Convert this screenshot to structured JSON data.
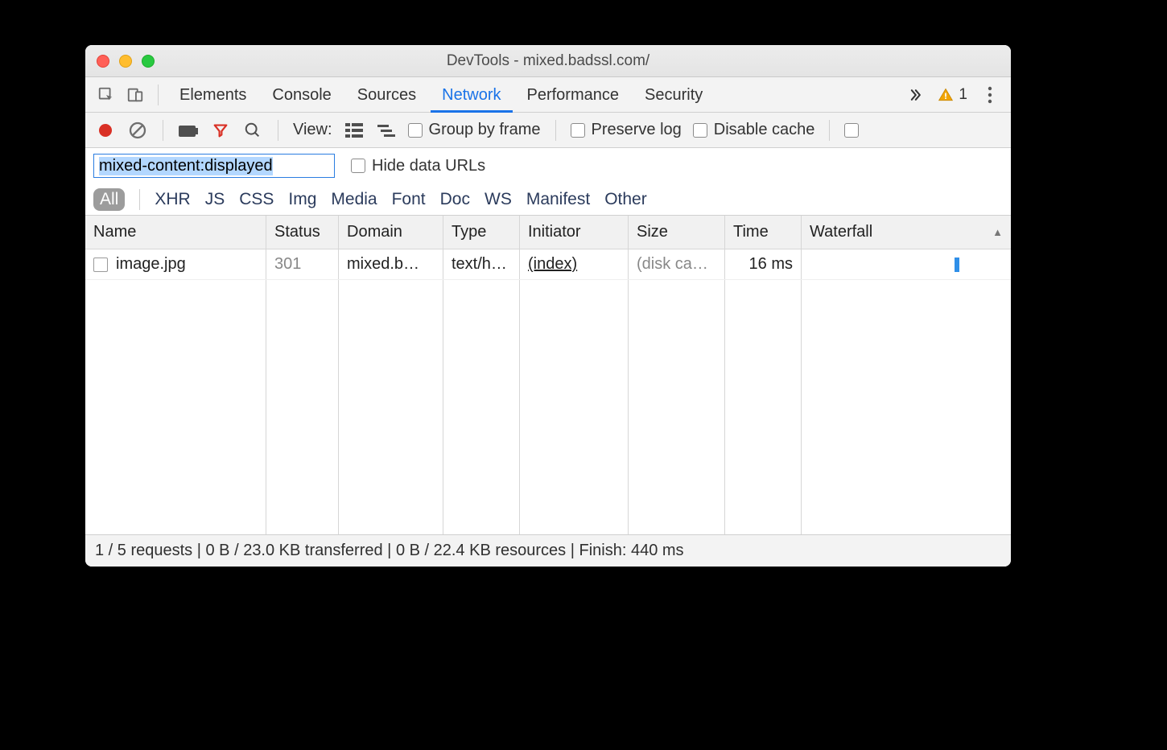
{
  "window": {
    "title": "DevTools - mixed.badssl.com/"
  },
  "tabs": {
    "items": [
      "Elements",
      "Console",
      "Sources",
      "Network",
      "Performance",
      "Security"
    ],
    "active": "Network",
    "warning_count": "1"
  },
  "toolbar": {
    "view_label": "View:",
    "group_by_frame": "Group by frame",
    "preserve_log": "Preserve log",
    "disable_cache": "Disable cache"
  },
  "filter": {
    "value": "mixed-content:displayed",
    "hide_data_urls": "Hide data URLs"
  },
  "type_filters": [
    "All",
    "XHR",
    "JS",
    "CSS",
    "Img",
    "Media",
    "Font",
    "Doc",
    "WS",
    "Manifest",
    "Other"
  ],
  "type_active": "All",
  "columns": [
    "Name",
    "Status",
    "Domain",
    "Type",
    "Initiator",
    "Size",
    "Time",
    "Waterfall"
  ],
  "sorted_col": "Waterfall",
  "rows": [
    {
      "name": "image.jpg",
      "status": "301",
      "domain": "mixed.b…",
      "type": "text/h…",
      "initiator": "(index)",
      "size": "(disk ca…",
      "time": "16 ms"
    }
  ],
  "status": {
    "requests": "1 / 5 requests",
    "transferred": "0 B / 23.0 KB transferred",
    "resources": "0 B / 22.4 KB resources",
    "finish": "Finish: 440 ms"
  }
}
